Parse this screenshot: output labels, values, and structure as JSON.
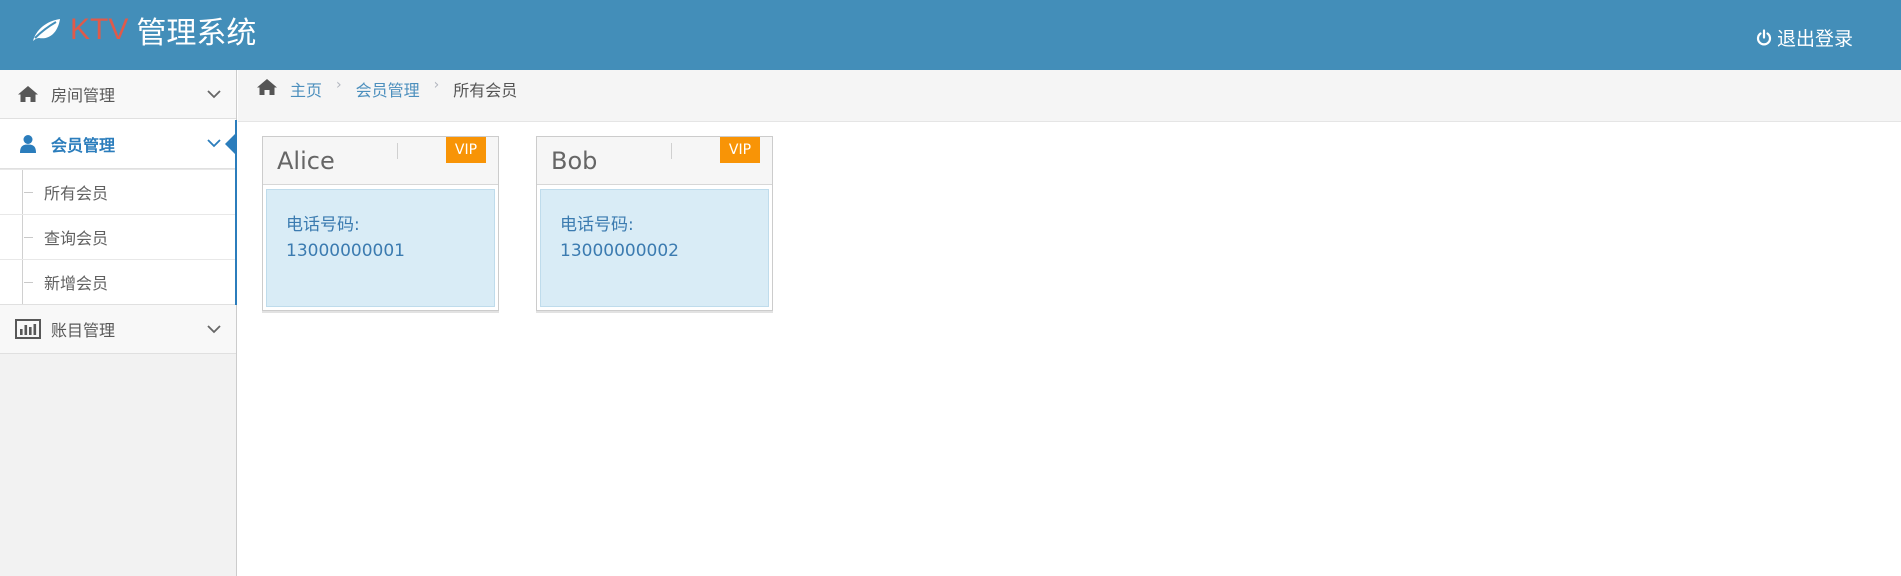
{
  "header": {
    "brand_ktv": "KTV",
    "brand_rest": "管理系统",
    "logout_label": "退出登录",
    "color": "#438eb9"
  },
  "sidebar": {
    "items": [
      {
        "label": "房间管理",
        "icon": "home-icon",
        "expanded": false
      },
      {
        "label": "会员管理",
        "icon": "user-icon",
        "expanded": true,
        "active": true,
        "sub": [
          {
            "label": "所有会员"
          },
          {
            "label": "查询会员"
          },
          {
            "label": "新增会员"
          }
        ]
      },
      {
        "label": "账目管理",
        "icon": "bar-chart-icon",
        "expanded": false
      }
    ]
  },
  "breadcrumb": {
    "home": "主页",
    "section": "会员管理",
    "current": "所有会员"
  },
  "members": [
    {
      "name": "Alice",
      "badge": "VIP",
      "phone_label": "电话号码:",
      "phone": "13000000001"
    },
    {
      "name": "Bob",
      "badge": "VIP",
      "phone_label": "电话号码:",
      "phone": "13000000002"
    }
  ],
  "colors": {
    "accent": "#2b7dbc",
    "vip": "#f89406",
    "ktv_red": "#e05a4a"
  }
}
